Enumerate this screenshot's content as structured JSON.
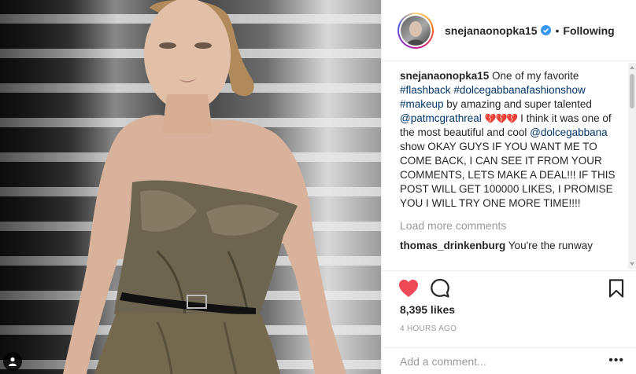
{
  "post": {
    "username": "snejanaonopka15",
    "follow_status": "Following",
    "separator": "•",
    "caption": {
      "username": "snejanaonopka15",
      "text_1": " One of my favorite ",
      "hashtag_1": "#flashback",
      "hashtag_2": "#dolcegabbanafashionshow",
      "hashtag_3": "#makeup",
      "text_2": " by amazing and super talented ",
      "mention_1": "@patmcgrathreal",
      "hearts": "💔💔💔",
      "text_3": " I think it was one of the most beautiful and cool ",
      "mention_2": "@dolcegabbana",
      "text_4": " show OKAY GUYS IF YOU WANT ME TO COME BACK, I CAN SEE IT FROM YOUR COMMENTS, LETS MAKE A DEAL!!! IF THIS POST WILL GET 100000 LIKES, I PROMISE YOU I WILL TRY ONE MORE TIME!!!!"
    },
    "load_more_label": "Load more comments",
    "comments": [
      {
        "username": "thomas_drinkenburg",
        "text": "You're the runway"
      }
    ],
    "likes_text": "8,395 likes",
    "timestamp": "4 HOURS AGO",
    "add_comment_placeholder": "Add a comment...",
    "more_options": "•••"
  },
  "icons": {
    "verified": "verified-badge-icon",
    "like": "heart-filled-icon",
    "comment": "comment-bubble-icon",
    "save": "bookmark-icon",
    "user_tag": "user-tag-icon"
  },
  "colors": {
    "like_red": "#ed4956",
    "verified_blue": "#3897f0",
    "link_blue": "#003569",
    "muted": "#999999"
  }
}
